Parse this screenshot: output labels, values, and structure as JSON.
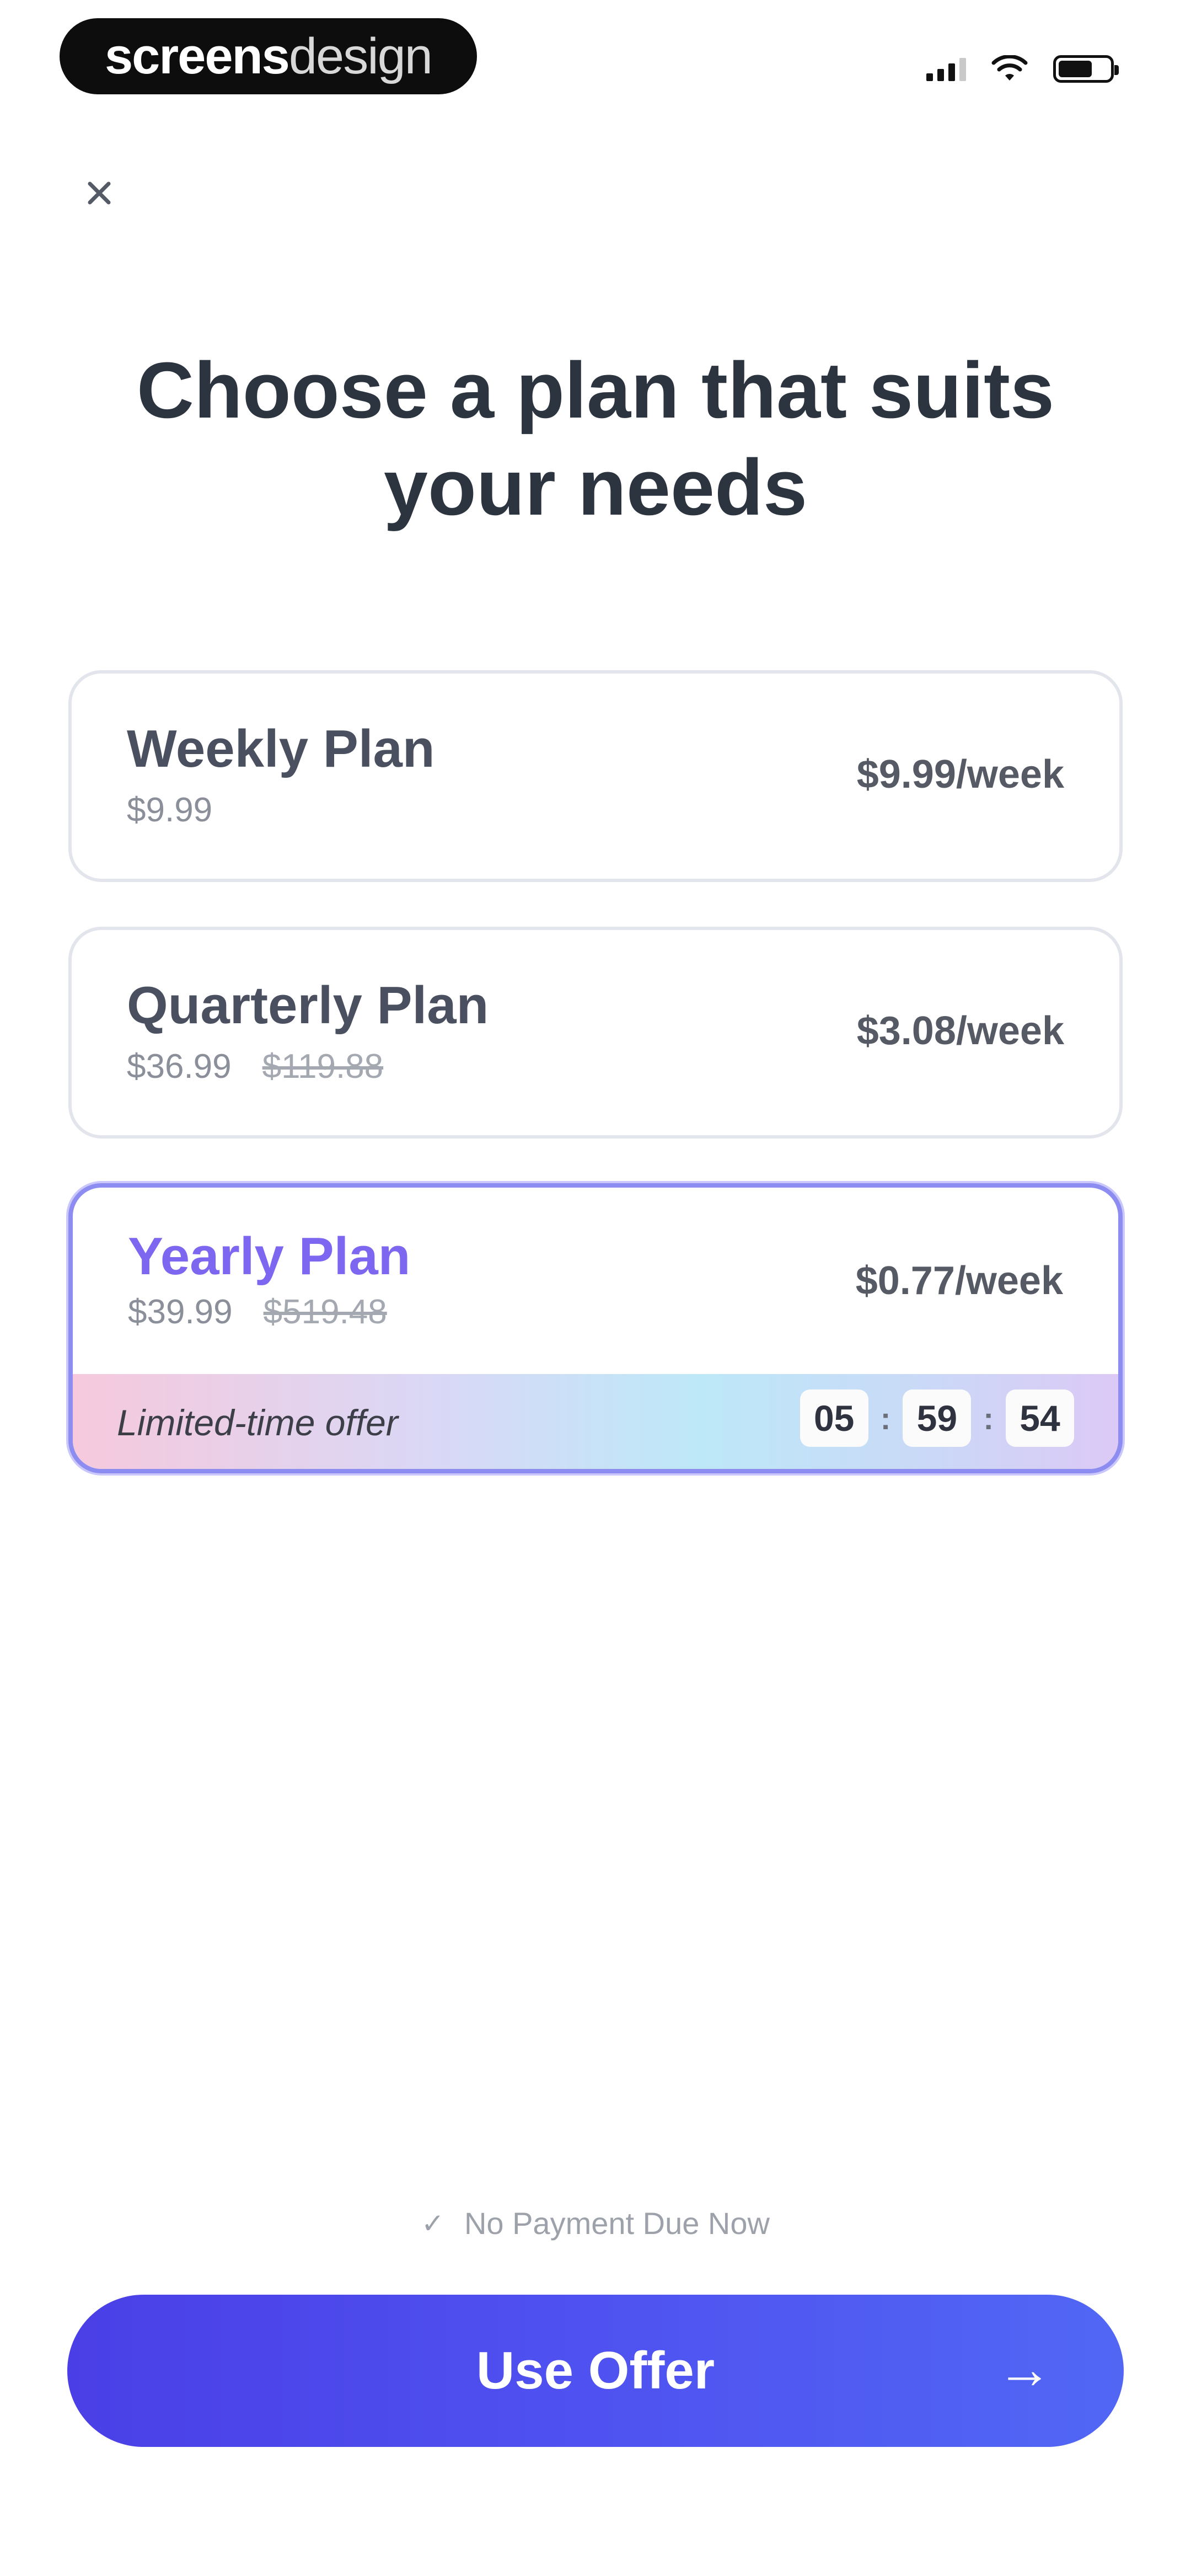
{
  "status_bar": {
    "brand_bold": "screens",
    "brand_light": "design"
  },
  "header": {
    "close_icon": "close-icon",
    "title": "Choose a plan that suits your needs"
  },
  "plans": [
    {
      "name": "Weekly Plan",
      "price": "$9.99",
      "original_price": "",
      "weekly": "$9.99/week",
      "selected": false
    },
    {
      "name": "Quarterly Plan",
      "price": "$36.99",
      "original_price": "$119.88",
      "weekly": "$3.08/week",
      "selected": false
    },
    {
      "name": "Yearly Plan",
      "price": "$39.99",
      "original_price": "$519.48",
      "weekly": "$0.77/week",
      "selected": true,
      "offer_label": "Limited-time offer",
      "timer": {
        "hours": "05",
        "minutes": "59",
        "seconds": "54",
        "separator": ":"
      }
    }
  ],
  "footer": {
    "no_payment": "No Payment Due Now",
    "cta_label": "Use Offer",
    "cta_arrow": "→"
  },
  "colors": {
    "accent": "#7e67f0",
    "cta_start": "#4a3fe6",
    "cta_end": "#5167f4"
  }
}
